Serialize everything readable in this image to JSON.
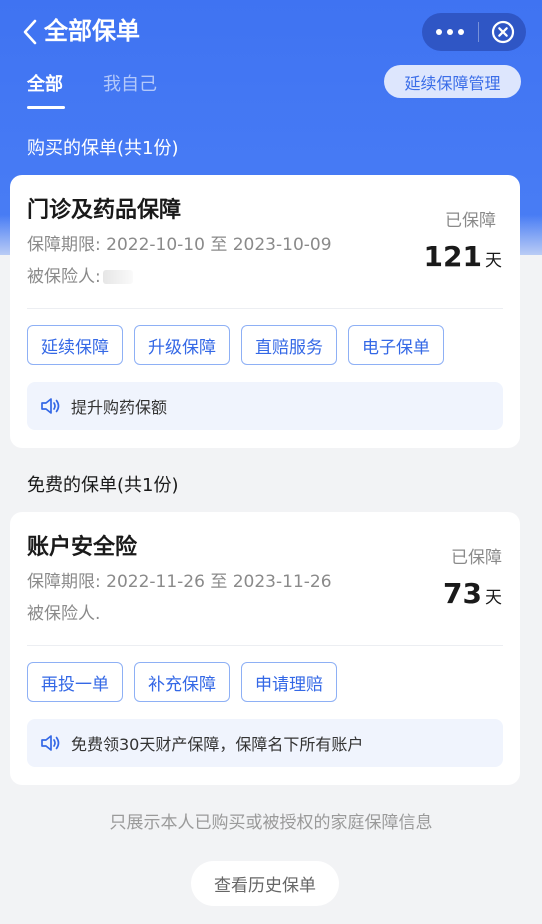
{
  "navbar": {
    "title": "全部保单",
    "back_icon": "chevron-left-icon",
    "more_icon": "more-dots-icon",
    "close_icon": "close-circle-icon"
  },
  "tabs": [
    {
      "label": "全部",
      "active": true
    },
    {
      "label": "我自己",
      "active": false
    }
  ],
  "manage_button": "延续保障管理",
  "sections": [
    {
      "title": "购买的保单(共1份)",
      "policy": {
        "name": "门诊及药品保障",
        "period": "保障期限: 2022-10-10 至 2023-10-09",
        "insured": "被保险人:",
        "status": "已保障",
        "days": "121",
        "days_unit": "天",
        "buttons": [
          "延续保障",
          "升级保障",
          "直赔服务",
          "电子保单"
        ],
        "notice": "提升购药保额"
      }
    },
    {
      "title": "免费的保单(共1份)",
      "policy": {
        "name": "账户安全险",
        "period": "保障期限: 2022-11-26 至 2023-11-26",
        "insured": "被保险人.",
        "status": "已保障",
        "days": "73",
        "days_unit": "天",
        "buttons": [
          "再投一单",
          "补充保障",
          "申请理赔"
        ],
        "notice": "免费领30天财产保障，保障名下所有账户"
      }
    }
  ],
  "footer": {
    "note": "只展示本人已购买或被授权的家庭保障信息",
    "history_button": "查看历史保单"
  },
  "colors": {
    "header_blue": "#3f73f2",
    "accent_blue": "#3468e6",
    "capsule": "#2f56c5"
  }
}
